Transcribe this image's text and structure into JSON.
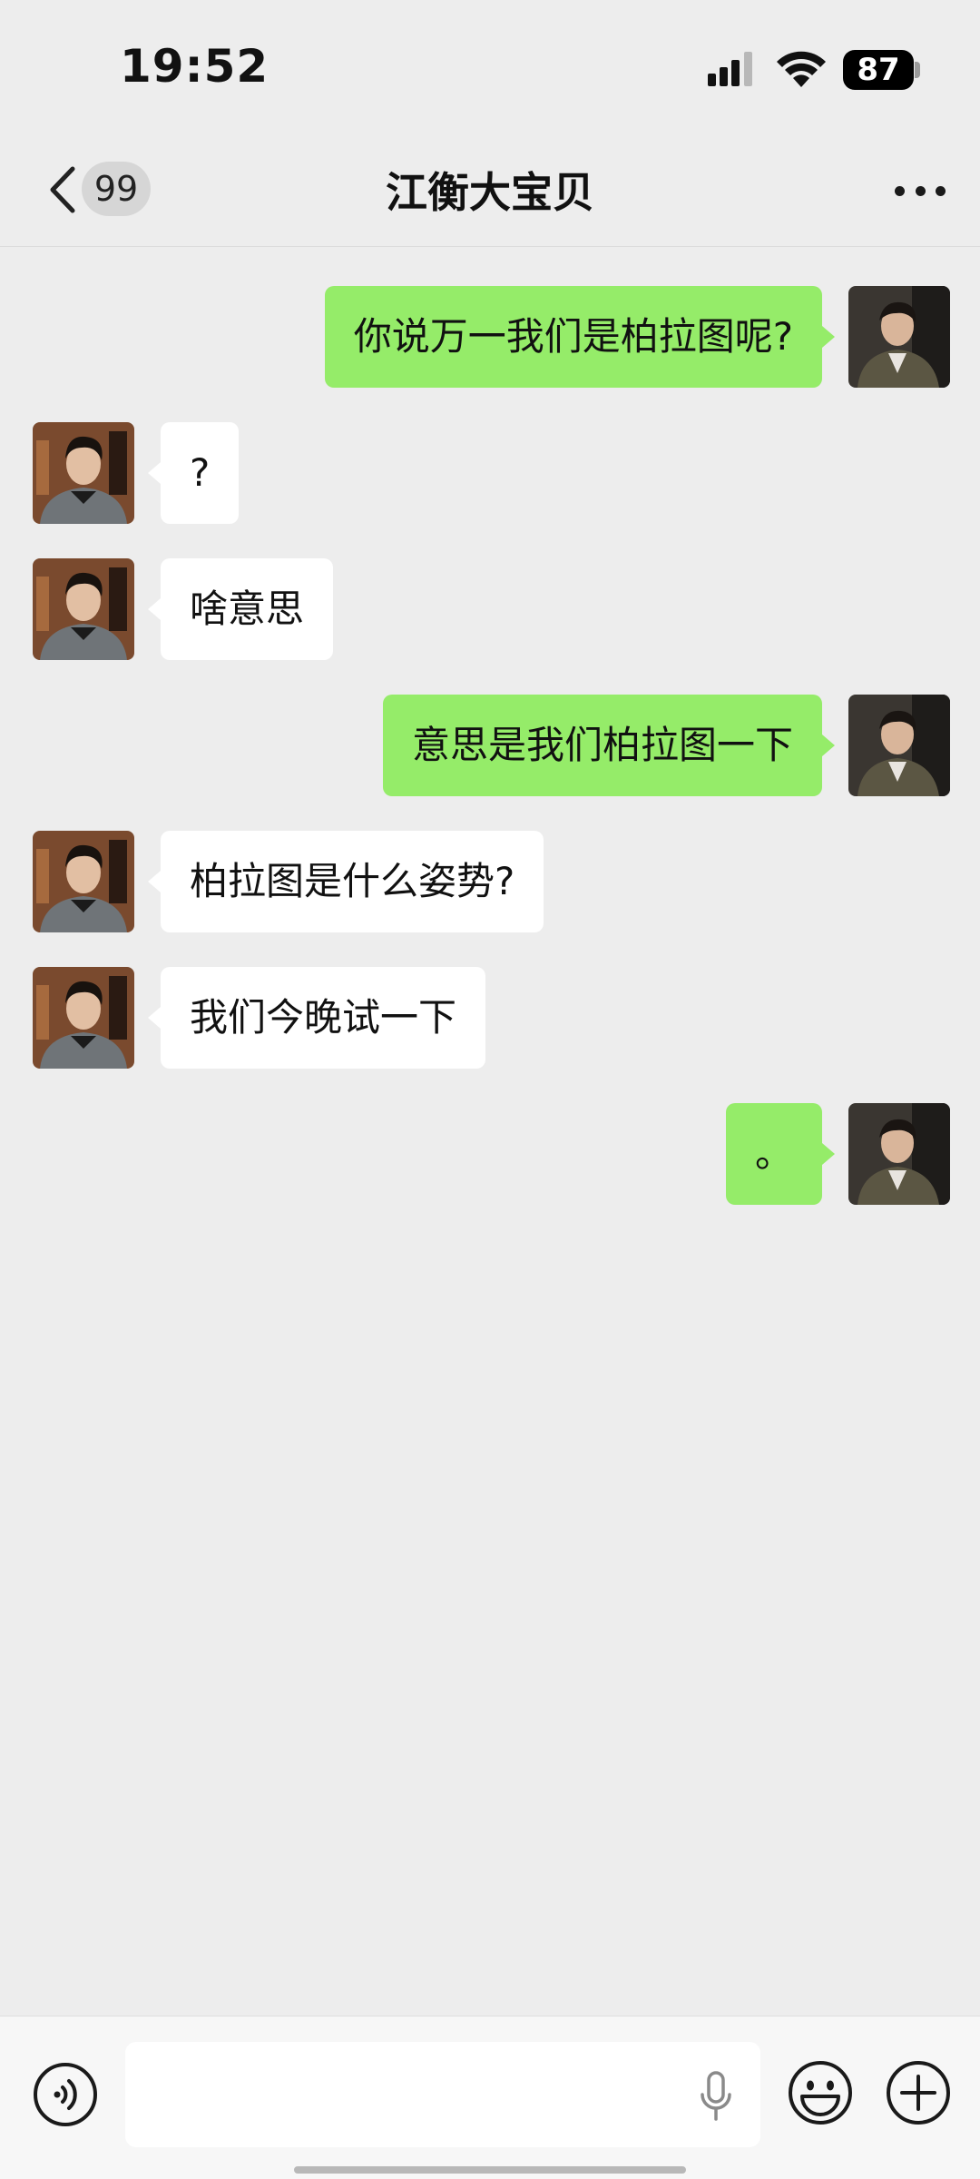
{
  "status_bar": {
    "time": "19:52",
    "battery": "87",
    "icons": [
      "signal-icon",
      "wifi-icon",
      "battery-icon"
    ]
  },
  "nav": {
    "back_icon": "chevron-left-icon",
    "unread_count": "99",
    "title": "江衡大宝贝",
    "more_icon": "more-dots-icon"
  },
  "messages": [
    {
      "direction": "out",
      "text": "你说万一我们是柏拉图呢?"
    },
    {
      "direction": "in",
      "text": "?"
    },
    {
      "direction": "in",
      "text": "啥意思"
    },
    {
      "direction": "out",
      "text": "意思是我们柏拉图一下"
    },
    {
      "direction": "in",
      "text": "柏拉图是什么姿势?"
    },
    {
      "direction": "in",
      "text": "我们今晚试一下"
    },
    {
      "direction": "out",
      "text": "。"
    }
  ],
  "input_bar": {
    "value": "",
    "icons": [
      "voice-icon",
      "mic-icon",
      "emoji-icon",
      "plus-icon"
    ]
  },
  "colors": {
    "background": "#ededed",
    "outgoing_bubble": "#95ec69",
    "incoming_bubble": "#ffffff"
  }
}
